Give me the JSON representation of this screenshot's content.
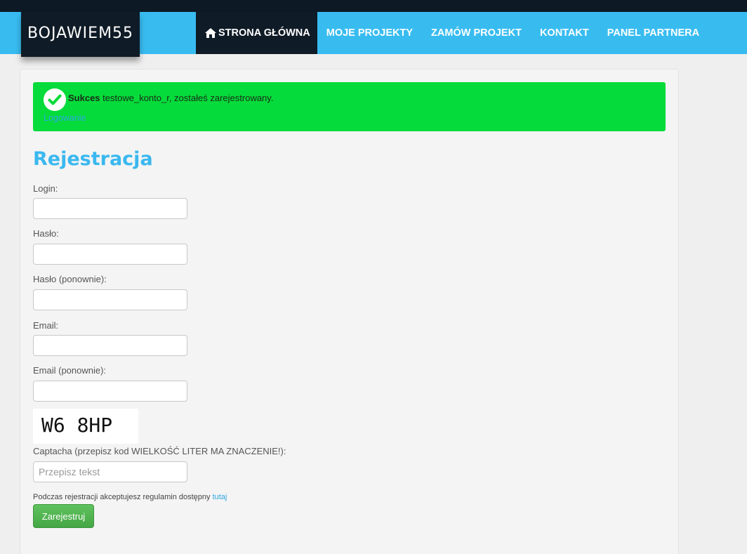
{
  "brand": "BOJAWIEM55",
  "nav": {
    "home": "STRONA GŁÓWNA",
    "projects": "MOJE PROJEKTY",
    "order": "ZAMÓW PROJEKT",
    "contact": "KONTAKT",
    "partner": "PANEL PARTNERA"
  },
  "alert": {
    "title": "Sukces",
    "message": " testowe_konto_r, zostałeś zarejestrowany.",
    "link": "Logowanie",
    "color": "#05db3a"
  },
  "form": {
    "heading": "Rejestracja",
    "login_label": "Login:",
    "login_value": "",
    "password_label": "Hasło:",
    "password_value": "",
    "password2_label": "Hasło (ponownie):",
    "password2_value": "",
    "email_label": "Email:",
    "email_value": "",
    "email2_label": "Email (ponownie):",
    "email2_value": "",
    "captcha_text": "W6 8HP",
    "captcha_label": "Captacha (przepisz kod WIELKOŚĆ LITER MA ZNACZENIE!):",
    "captcha_placeholder": "Przepisz tekst",
    "captcha_value": "",
    "terms_text": "Podczas rejestracji akceptujesz regulamin dostępny ",
    "terms_link": "tutaj",
    "submit": "Zarejestruj"
  },
  "colors": {
    "accent": "#38bcf0",
    "dark": "#0f1b26",
    "button": "#4cae4c"
  }
}
